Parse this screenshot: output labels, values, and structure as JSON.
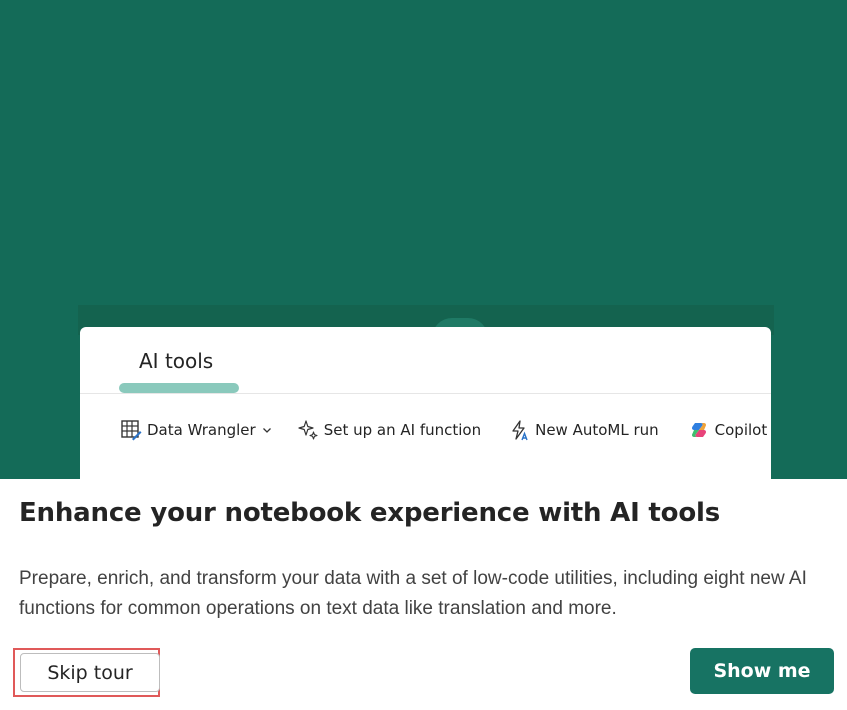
{
  "panel": {
    "tab_label": "AI tools",
    "tools": [
      {
        "label": "Data Wrangler",
        "icon": "data-wrangler-icon",
        "has_dropdown": true
      },
      {
        "label": "Set up an AI function",
        "icon": "sparkle-icon"
      },
      {
        "label": "New AutoML run",
        "icon": "automl-icon"
      },
      {
        "label": "Copilot",
        "icon": "copilot-icon"
      }
    ]
  },
  "dialog": {
    "title": "Enhance your notebook experience with AI tools",
    "description": "Prepare, enrich, and transform your data with a set of low-code utilities, including eight new AI functions for common operations on text data like translation and more.",
    "skip_label": "Skip tour",
    "show_label": "Show me"
  },
  "colors": {
    "hero_background": "#146b58",
    "tab_indicator": "#8ac9bc",
    "primary_button": "#177363",
    "highlight_outline": "#e05959"
  }
}
